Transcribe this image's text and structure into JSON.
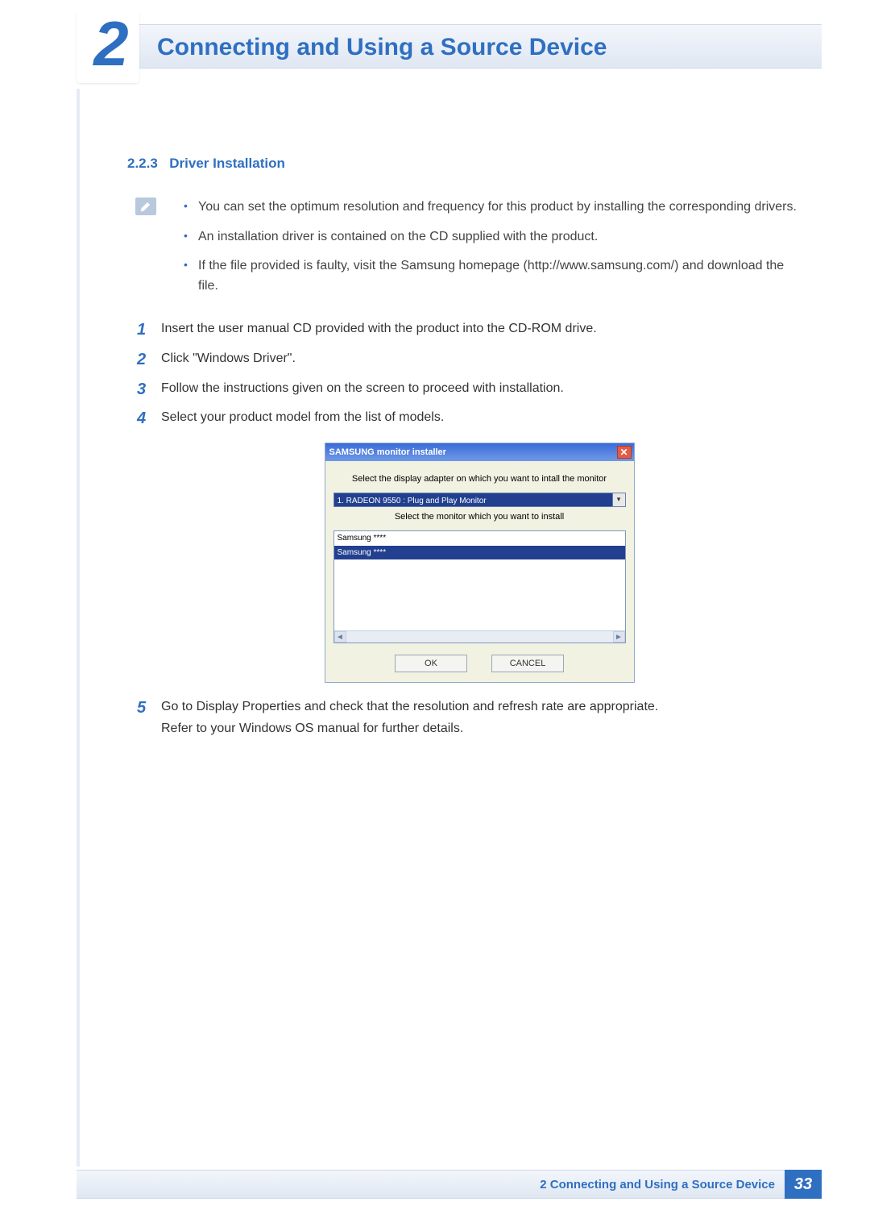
{
  "header": {
    "chapter_number": "2",
    "chapter_title": "Connecting and Using a Source Device"
  },
  "section": {
    "number": "2.2.3",
    "title": "Driver Installation"
  },
  "note": {
    "items": [
      "You can set the optimum resolution and frequency for this product by installing the corresponding drivers.",
      "An installation driver is contained on the CD supplied with the product.",
      "If the file provided is faulty, visit the Samsung homepage (http://www.samsung.com/) and download the file."
    ]
  },
  "steps": [
    {
      "n": "1",
      "text": "Insert the user manual CD provided with the product into the CD-ROM drive."
    },
    {
      "n": "2",
      "text": "Click \"Windows Driver\"."
    },
    {
      "n": "3",
      "text": "Follow the instructions given on the screen to proceed with installation."
    },
    {
      "n": "4",
      "text": "Select your product model from the list of models."
    },
    {
      "n": "5",
      "text": "Go to Display Properties and check that the resolution and refresh rate are appropriate."
    }
  ],
  "step5_extra": "Refer to your Windows OS manual for further details.",
  "installer": {
    "title": "SAMSUNG monitor installer",
    "label_adapter": "Select the display adapter on which you want to intall the monitor",
    "combo_value": "1. RADEON 9550 : Plug and Play Monitor",
    "label_monitor": "Select the monitor which you want to install",
    "list_item_1": "Samsung ****",
    "list_item_selected": "Samsung ****",
    "ok": "OK",
    "cancel": "CANCEL"
  },
  "footer": {
    "text": "2 Connecting and Using a Source Device",
    "page": "33"
  }
}
